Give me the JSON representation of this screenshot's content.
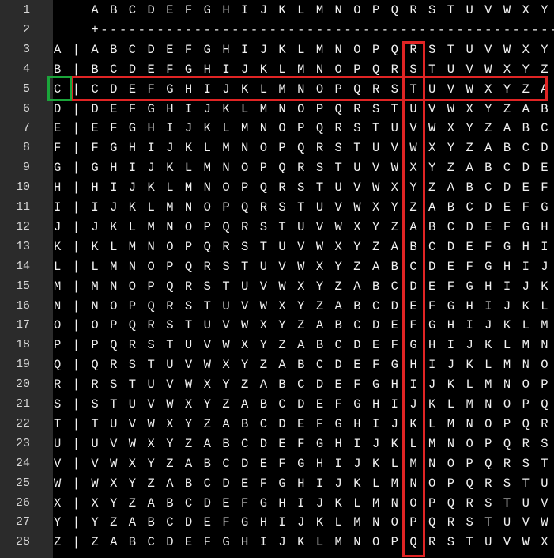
{
  "editor": {
    "line_numbers": [
      "1",
      "2",
      "3",
      "4",
      "5",
      "6",
      "7",
      "8",
      "9",
      "10",
      "11",
      "12",
      "13",
      "14",
      "15",
      "16",
      "17",
      "18",
      "19",
      "20",
      "21",
      "22",
      "23",
      "24",
      "25",
      "26",
      "27",
      "28"
    ],
    "lines": [
      "    A B C D E F G H I J K L M N O P Q R S T U V W X Y Z",
      "    +---------------------------------------------------",
      "A | A B C D E F G H I J K L M N O P Q R S T U V W X Y Z",
      "B | B C D E F G H I J K L M N O P Q R S T U V W X Y Z A",
      "C | C D E F G H I J K L M N O P Q R S T U V W X Y Z A B",
      "D | D E F G H I J K L M N O P Q R S T U V W X Y Z A B C",
      "E | E F G H I J K L M N O P Q R S T U V W X Y Z A B C D",
      "F | F G H I J K L M N O P Q R S T U V W X Y Z A B C D E",
      "G | G H I J K L M N O P Q R S T U V W X Y Z A B C D E F",
      "H | H I J K L M N O P Q R S T U V W X Y Z A B C D E F G",
      "I | I J K L M N O P Q R S T U V W X Y Z A B C D E F G H",
      "J | J K L M N O P Q R S T U V W X Y Z A B C D E F G H I",
      "K | K L M N O P Q R S T U V W X Y Z A B C D E F G H I J",
      "L | L M N O P Q R S T U V W X Y Z A B C D E F G H I J K",
      "M | M N O P Q R S T U V W X Y Z A B C D E F G H I J K L",
      "N | N O P Q R S T U V W X Y Z A B C D E F G H I J K L M",
      "O | O P Q R S T U V W X Y Z A B C D E F G H I J K L M N",
      "P | P Q R S T U V W X Y Z A B C D E F G H I J K L M N O",
      "Q | Q R S T U V W X Y Z A B C D E F G H I J K L M N O P",
      "R | R S T U V W X Y Z A B C D E F G H I J K L M N O P Q",
      "S | S T U V W X Y Z A B C D E F G H I J K L M N O P Q R",
      "T | T U V W X Y Z A B C D E F G H I J K L M N O P Q R S",
      "U | U V W X Y Z A B C D E F G H I J K L M N O P Q R S T",
      "V | V W X Y Z A B C D E F G H I J K L M N O P Q R S T U",
      "W | W X Y Z A B C D E F G H I J K L M N O P Q R S T U V",
      "X | X Y Z A B C D E F G H I J K L M N O P Q R S T U V W",
      "Y | Y Z A B C D E F G H I J K L M N O P Q R S T U V W X",
      "Z | Z A B C D E F G H I J K L M N O P Q R S T U V W X Y"
    ]
  },
  "highlights": {
    "row_color": "#e02424",
    "column_color": "#e02424",
    "key_color": "#1aa53a"
  }
}
